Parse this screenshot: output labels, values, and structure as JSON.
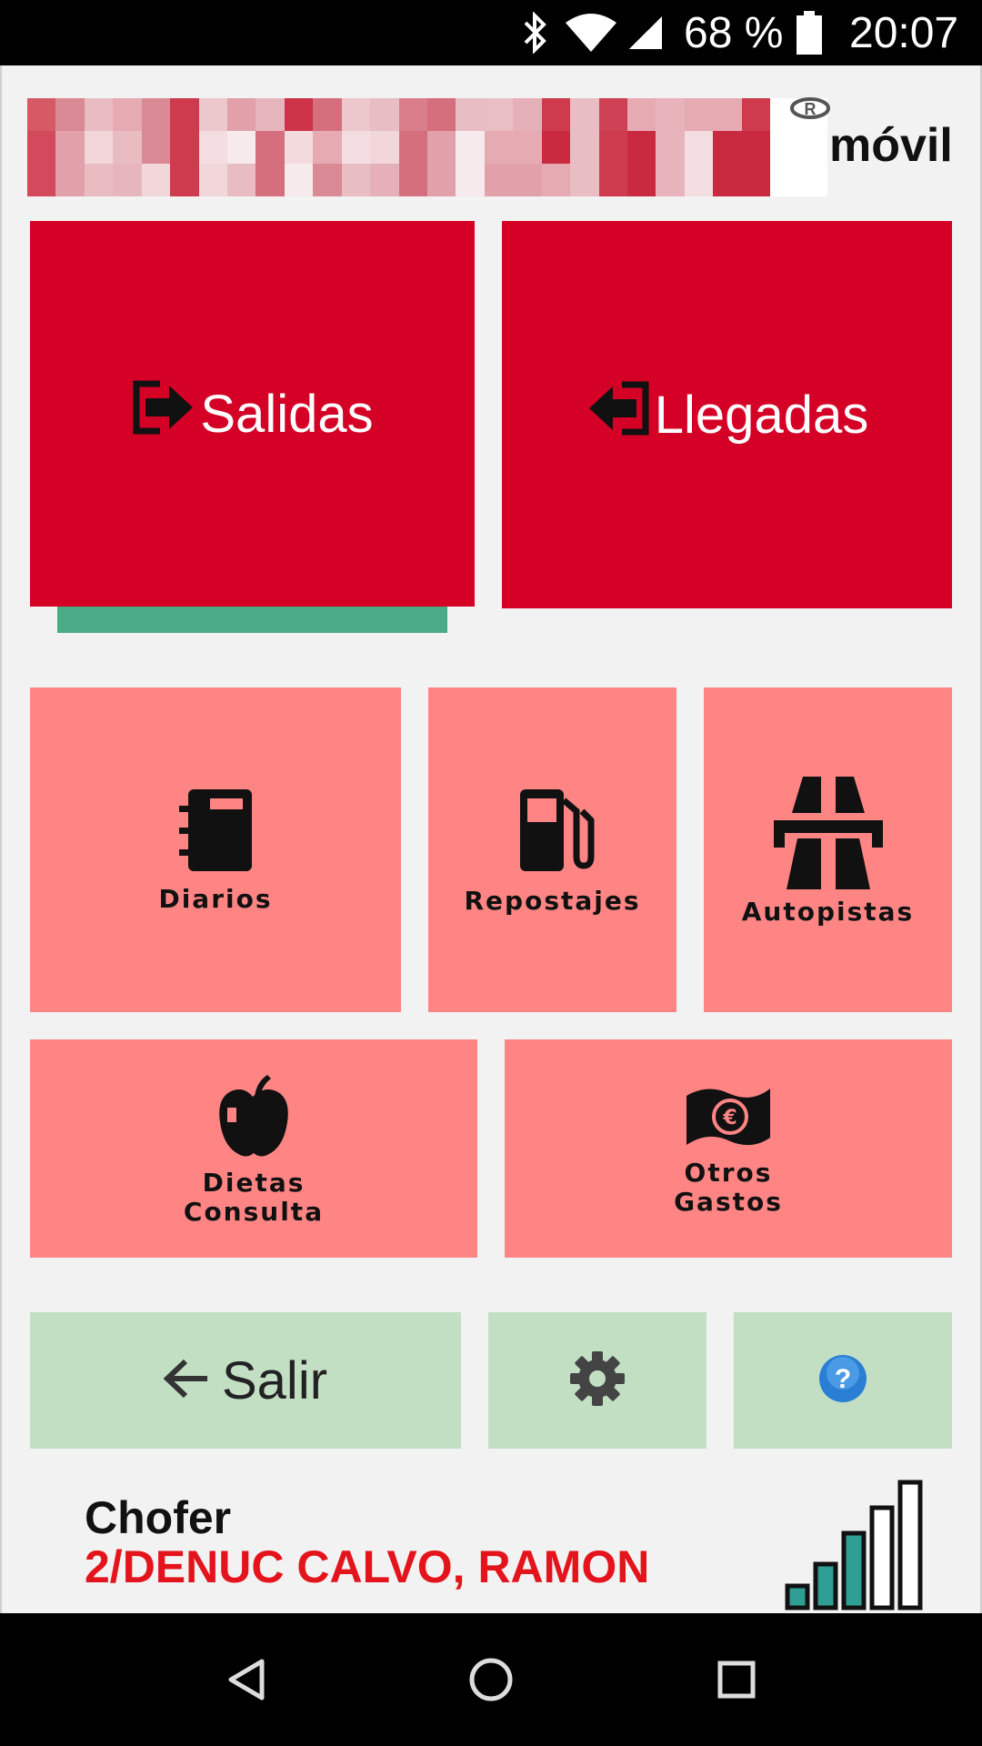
{
  "status_bar": {
    "battery_text": "68 %",
    "time": "20:07",
    "icons": [
      "bluetooth-icon",
      "wifi-icon",
      "cell-signal-icon",
      "battery-icon"
    ]
  },
  "header": {
    "logo_suffix": "móvil",
    "registered_mark": "R"
  },
  "main_actions": {
    "salidas": {
      "label": "Salidas",
      "icon": "exit-icon",
      "progress": 1.0,
      "progress_color": "#4aab86"
    },
    "llegadas": {
      "label": "Llegadas",
      "icon": "enter-icon"
    }
  },
  "tools": {
    "diarios": {
      "label": "Diarios",
      "icon": "notebook-icon"
    },
    "repostajes": {
      "label": "Repostajes",
      "icon": "fuel-pump-icon"
    },
    "autopistas": {
      "label": "Autopistas",
      "icon": "highway-icon"
    },
    "dietas": {
      "label_line1": "Dietas",
      "label_line2": "Consulta",
      "icon": "apple-icon"
    },
    "otros_gastos": {
      "label_line1": "Otros",
      "label_line2": "Gastos",
      "icon": "euro-banknote-icon"
    }
  },
  "footer_actions": {
    "salir": {
      "label": "Salir",
      "icon": "arrow-left-icon"
    },
    "settings": {
      "icon": "gear-icon"
    },
    "help": {
      "icon": "help-icon",
      "text": "?"
    }
  },
  "driver": {
    "title": "Chofer",
    "name": "2/DENUC CALVO, RAMON",
    "signal_level": 3,
    "signal_max": 5
  },
  "colors": {
    "primary_red": "#d50026",
    "tile_pink": "#ff8585",
    "tile_green": "#c2dfc4",
    "driver_name_red": "#e4141c"
  }
}
